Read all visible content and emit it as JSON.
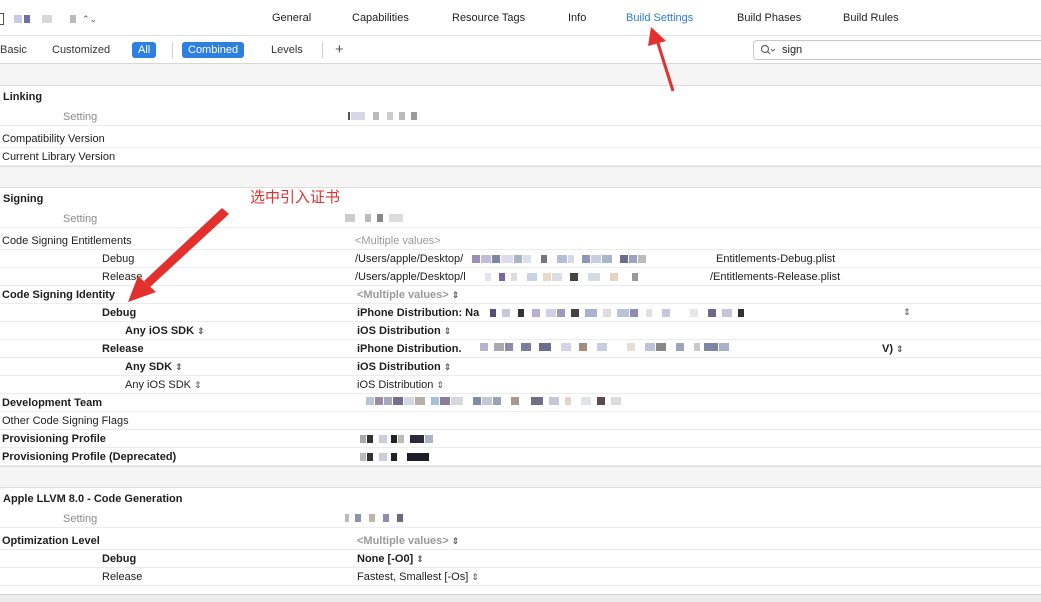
{
  "tabs": [
    "General",
    "Capabilities",
    "Resource Tags",
    "Info",
    "Build Settings",
    "Build Phases",
    "Build Rules"
  ],
  "active_tab": "Build Settings",
  "filters": {
    "basic": "Basic",
    "customized": "Customized",
    "all": "All",
    "combined": "Combined",
    "levels": "Levels",
    "plus": "+"
  },
  "search": {
    "value": "sign"
  },
  "annotation": "选中引入证书",
  "colors": {
    "accent": "#2d7fe2",
    "annotation": "#e3302d"
  },
  "sections": {
    "linking": {
      "title": "Linking",
      "setting_header": "Setting",
      "rows": [
        "Compatibility Version",
        "Current Library Version"
      ]
    },
    "signing": {
      "title": "Signing",
      "setting_header": "Setting",
      "entitlements": {
        "label": "Code Signing Entitlements",
        "value": "<Multiple values>",
        "debug_label": "Debug",
        "debug_value_prefix": "/Users/apple/Desktop/",
        "debug_value_suffix": "Entitlements-Debug.plist",
        "release_label": "Release",
        "release_value_prefix": "/Users/apple/Desktop/l",
        "release_value_suffix": "/Entitlements-Release.plist"
      },
      "identity": {
        "label": "Code Signing Identity",
        "value": "<Multiple values>",
        "debug_label": "Debug",
        "debug_value": "iPhone Distribution: Na",
        "debug_sdk_label": "Any iOS SDK",
        "debug_sdk_value": "iOS Distribution",
        "release_label": "Release",
        "release_value": "iPhone Distribution.",
        "release_value_suffix": "V)",
        "release_sdk_label": "Any SDK",
        "release_sdk_value": "iOS Distribution",
        "release_ios_sdk_label": "Any iOS SDK",
        "release_ios_sdk_value": "iOS Distribution"
      },
      "development_team": "Development Team",
      "other_flags": "Other Code Signing Flags",
      "provisioning_profile": "Provisioning Profile",
      "provisioning_profile_deprecated": "Provisioning Profile (Deprecated)"
    },
    "codegen": {
      "title": "Apple LLVM 8.0 - Code Generation",
      "setting_header": "Setting",
      "optimization_label": "Optimization Level",
      "optimization_value": "<Multiple values>",
      "debug_label": "Debug",
      "debug_value": "None [-O0]",
      "release_label": "Release",
      "release_value": "Fastest, Smallest [-Os]"
    }
  }
}
